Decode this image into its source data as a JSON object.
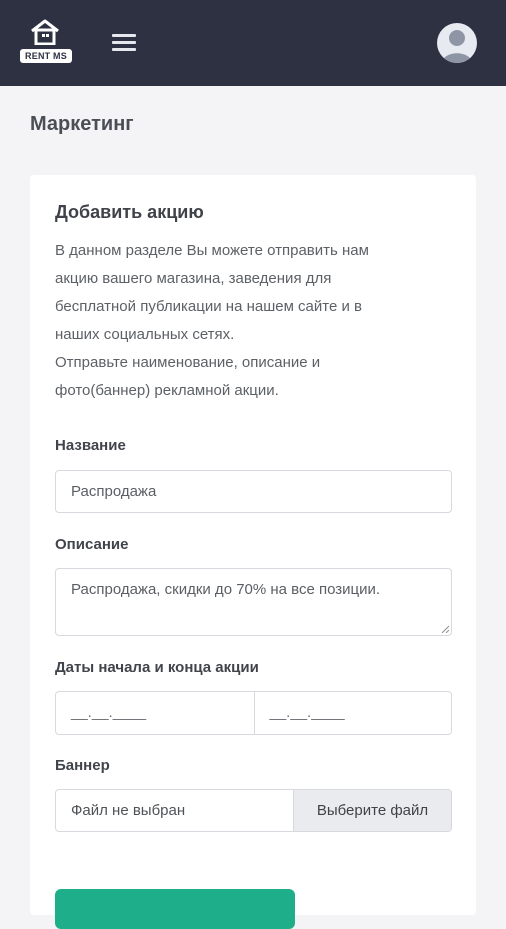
{
  "header": {
    "logo_text": "RENT MS",
    "menu_icon": "hamburger-icon",
    "avatar_icon": "user-avatar-icon",
    "bg_color": "#2d3142"
  },
  "page": {
    "title": "Маркетинг"
  },
  "card": {
    "title": "Добавить акцию",
    "description": [
      "В данном разделе Вы можете отправить нам",
      "акцию вашего магазина, заведения для",
      "бесплатной публикации на нашем сайте и в",
      "наших социальных сетях.",
      "Отправьте наименование, описание и",
      "фото(баннер) рекламной акции."
    ]
  },
  "form": {
    "name_label": "Название",
    "name_value": "Распродажа",
    "description_label": "Описание",
    "description_value": "Распродажа, скидки до 70% на все позиции.",
    "dates_label": "Даты начала и конца акции",
    "date_start_placeholder": "__.__.____",
    "date_end_placeholder": "__.__.____",
    "banner_label": "Баннер",
    "file_status": "Файл не выбран",
    "file_button": "Выберите файл",
    "accent_color": "#1eaf8a"
  }
}
